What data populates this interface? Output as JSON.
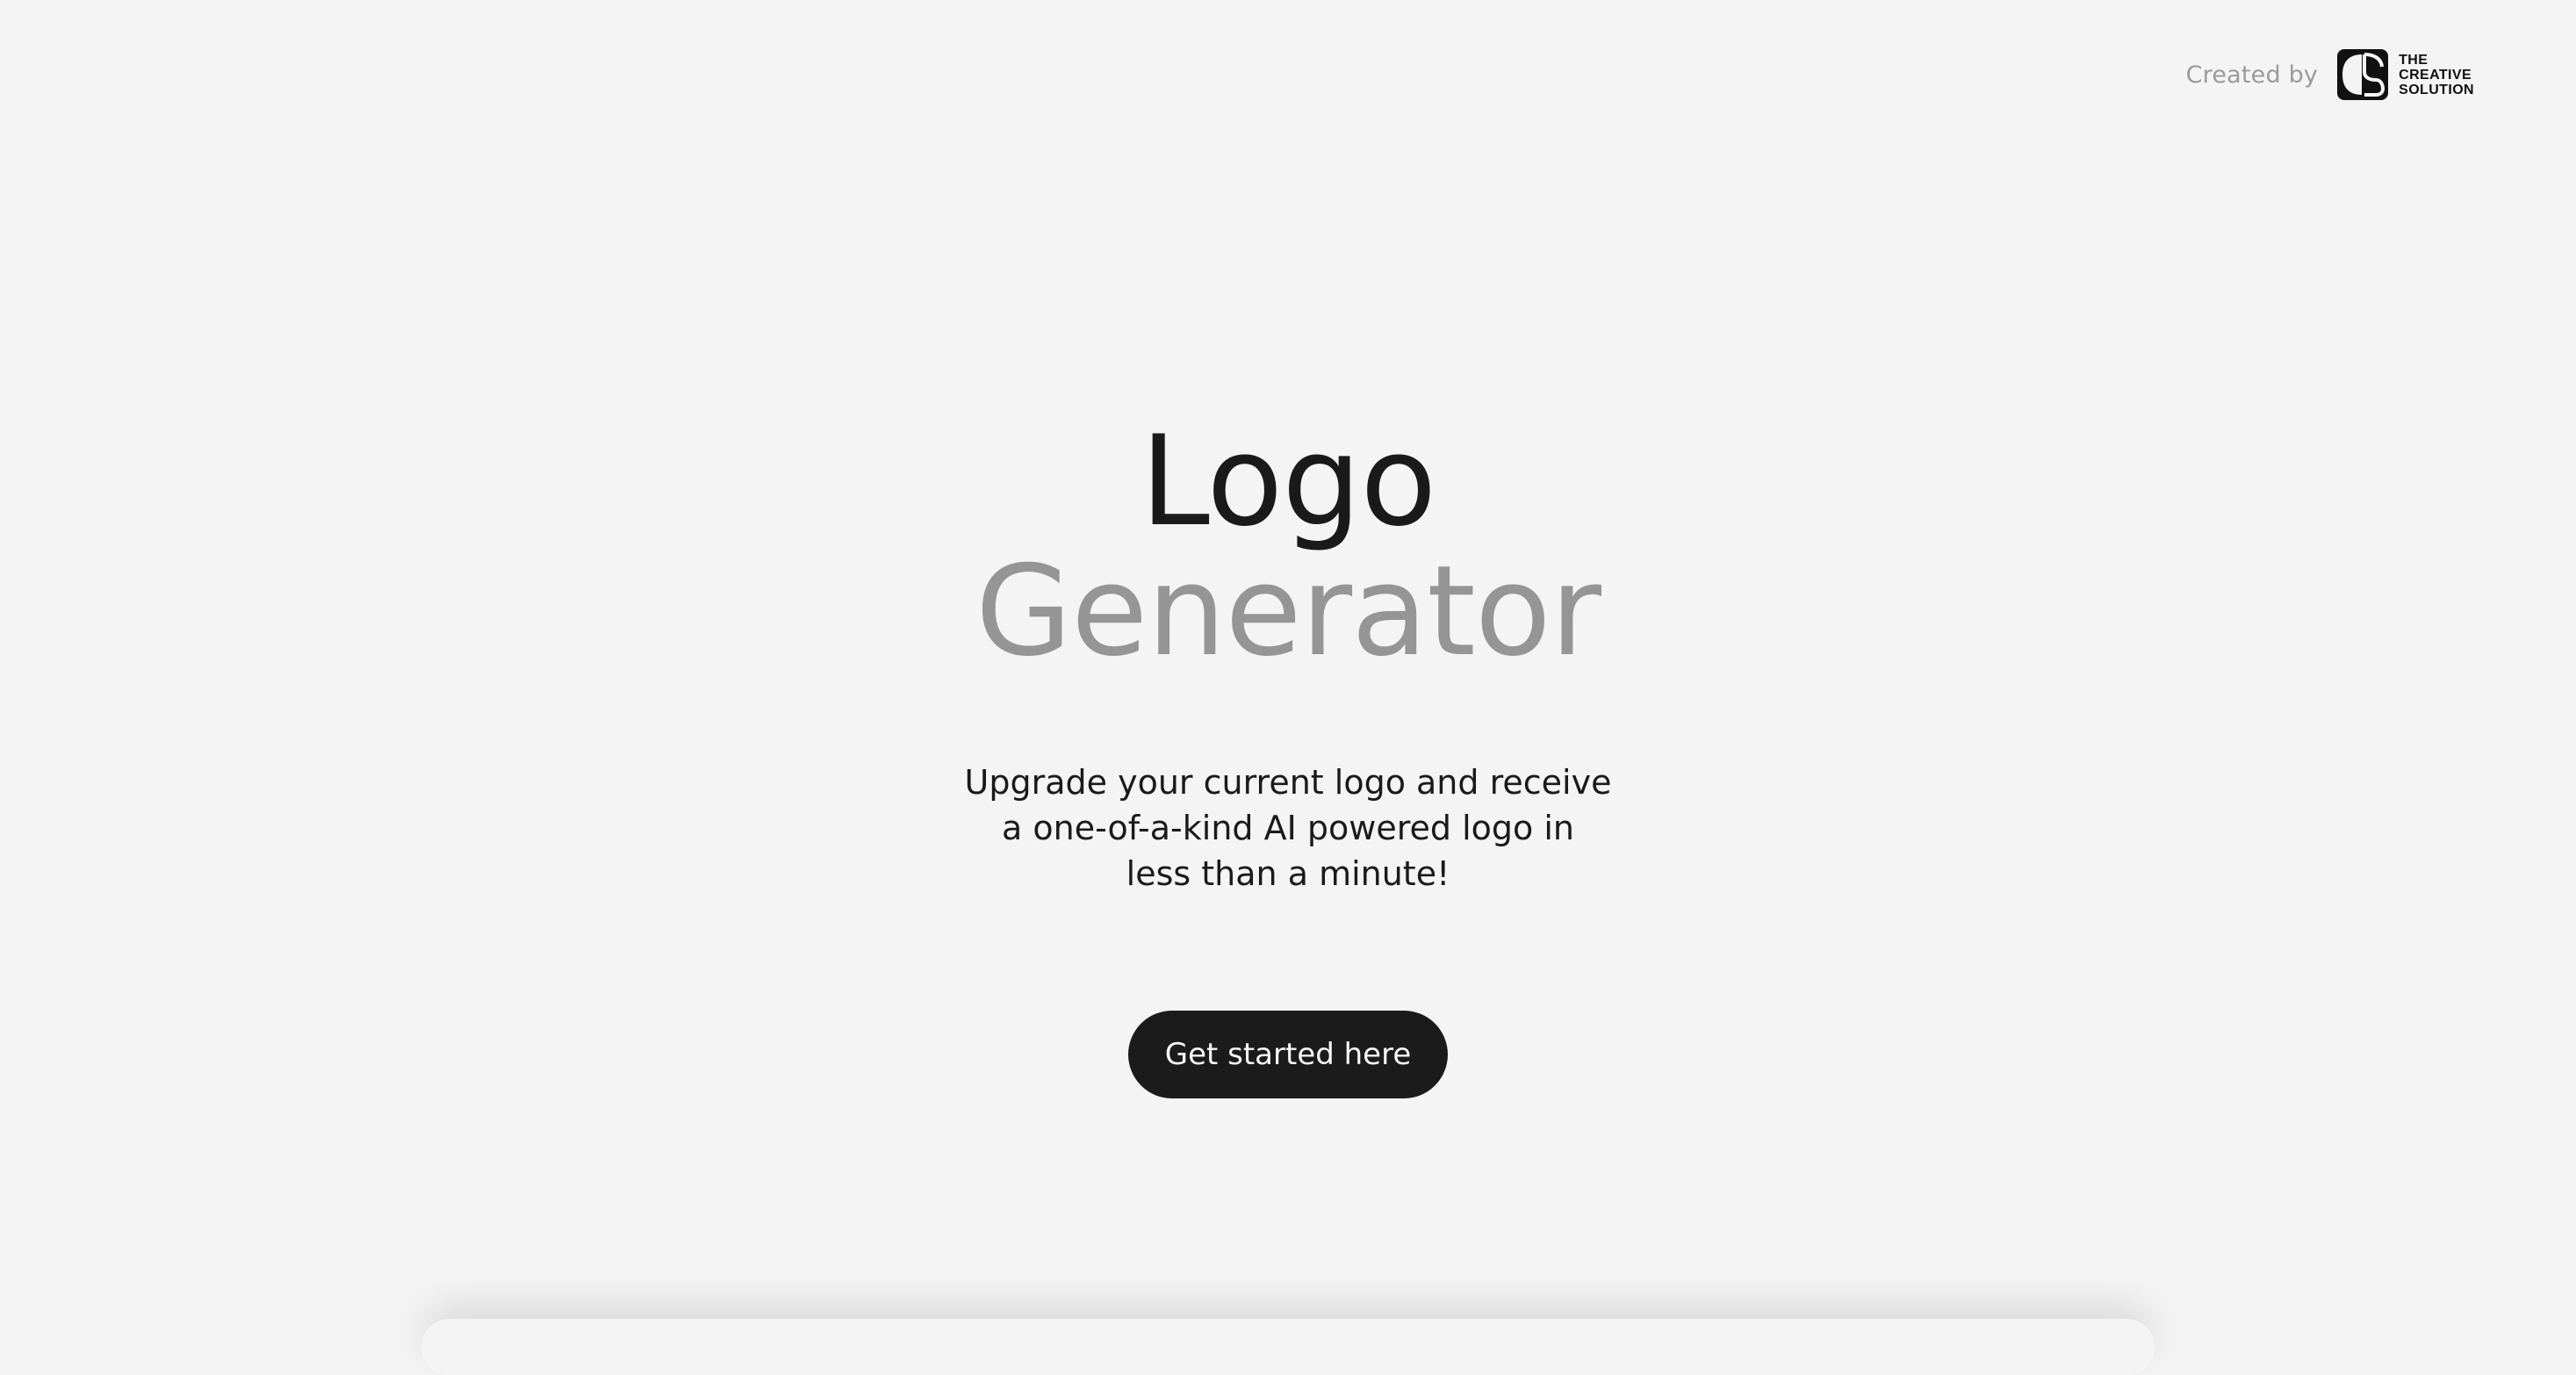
{
  "header": {
    "created_by_label": "Created by",
    "brand": {
      "line1": "THE",
      "line2": "CREATIVE",
      "line3": "SOLUTION",
      "logo_icon": "cs-monogram-icon"
    }
  },
  "hero": {
    "title_line_1": "Logo",
    "title_line_2": "Generator",
    "subtitle_line_1": "Upgrade your current logo and receive",
    "subtitle_line_2": "a one-of-a-kind AI powered logo in",
    "subtitle_line_3": "less than a minute!",
    "cta_label": "Get started here"
  },
  "colors": {
    "background": "#f4f4f4",
    "text_primary": "#1a1a1a",
    "text_secondary": "#959595",
    "button_bg": "#1b1b1b",
    "button_text": "#f6f6f6"
  }
}
